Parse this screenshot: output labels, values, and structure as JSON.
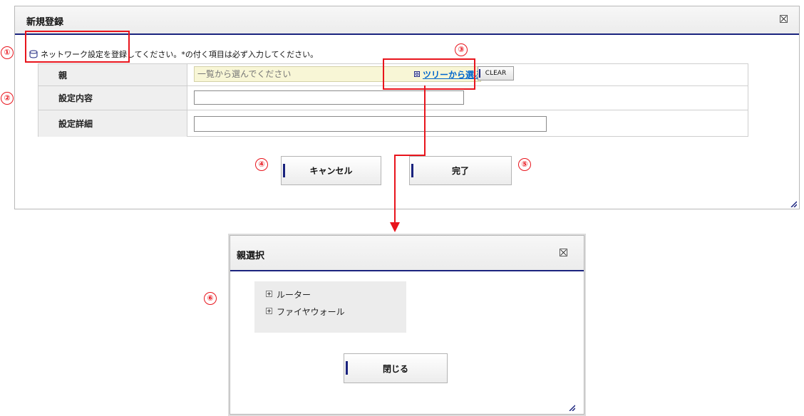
{
  "dialog_main": {
    "title": "新規登録",
    "notice": "ネットワーク設定を登録してください。*の付く項目は必ず入力してください。",
    "fields": [
      {
        "label": "親",
        "placeholder": "一覧から選んでください"
      },
      {
        "label": "設定内容",
        "value": ""
      },
      {
        "label": "設定詳細",
        "value": ""
      }
    ],
    "tree_link": "ツリーから選ぶ",
    "clear_label": "CLEAR",
    "cancel_label": "キャンセル",
    "done_label": "完了"
  },
  "dialog_parent": {
    "title": "親選択",
    "tree_items": [
      "ルーター",
      "ファイヤウォール"
    ],
    "close_label": "閉じる"
  },
  "annotations": [
    "①",
    "②",
    "③",
    "④",
    "⑤",
    "⑥"
  ],
  "colors": {
    "accent": "#1a237e",
    "annotation": "#e8141c",
    "link": "#0066cc",
    "readonly_bg": "#f8f6d6"
  }
}
